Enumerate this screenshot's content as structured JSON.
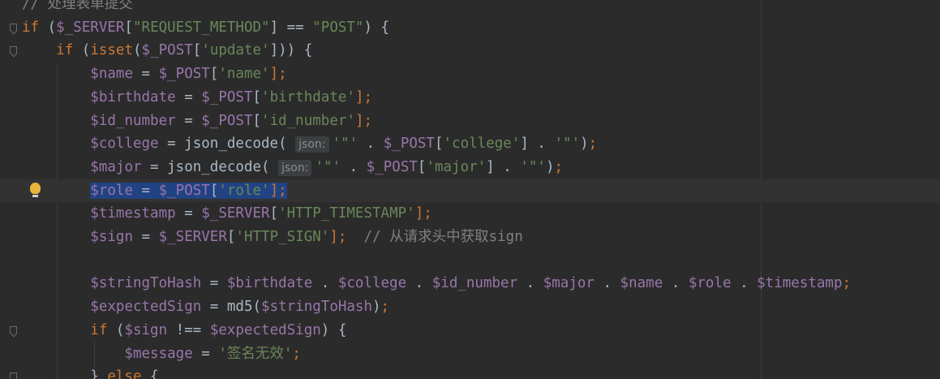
{
  "editor": {
    "language": "php",
    "colors": {
      "background": "#2b2b2b",
      "keyword": "#cc7832",
      "variable": "#9876aa",
      "string": "#6a8759",
      "function": "#ffc66d",
      "comment": "#808080",
      "selection": "#214283"
    },
    "lines": [
      {
        "tokens": [
          {
            "t": "cm",
            "v": "// 处理表单提交"
          }
        ]
      },
      {
        "fold": true,
        "tokens": [
          {
            "t": "kw",
            "v": "if"
          },
          {
            "t": "punct",
            "v": " ("
          },
          {
            "t": "var",
            "v": "$_SERVER"
          },
          {
            "t": "punct",
            "v": "["
          },
          {
            "t": "str",
            "v": "\"REQUEST_METHOD\""
          },
          {
            "t": "punct",
            "v": "] == "
          },
          {
            "t": "str",
            "v": "\"POST\""
          },
          {
            "t": "punct",
            "v": ") {"
          }
        ]
      },
      {
        "fold": true,
        "tokens": [
          {
            "t": "punct",
            "v": "    "
          },
          {
            "t": "kw",
            "v": "if"
          },
          {
            "t": "punct",
            "v": " ("
          },
          {
            "t": "kw",
            "v": "isset"
          },
          {
            "t": "punct",
            "v": "("
          },
          {
            "t": "var",
            "v": "$_POST"
          },
          {
            "t": "punct",
            "v": "["
          },
          {
            "t": "str",
            "v": "'update'"
          },
          {
            "t": "punct",
            "v": "])) {"
          }
        ]
      },
      {
        "tokens": [
          {
            "t": "punct",
            "v": "        "
          },
          {
            "t": "var",
            "v": "$name"
          },
          {
            "t": "punct",
            "v": " = "
          },
          {
            "t": "var",
            "v": "$_POST"
          },
          {
            "t": "punct",
            "v": "["
          },
          {
            "t": "str",
            "v": "'name'"
          },
          {
            "t": "kw",
            "v": "];"
          }
        ]
      },
      {
        "tokens": [
          {
            "t": "punct",
            "v": "        "
          },
          {
            "t": "var",
            "v": "$birthdate"
          },
          {
            "t": "punct",
            "v": " = "
          },
          {
            "t": "var",
            "v": "$_POST"
          },
          {
            "t": "punct",
            "v": "["
          },
          {
            "t": "str",
            "v": "'birthdate'"
          },
          {
            "t": "kw",
            "v": "];"
          }
        ]
      },
      {
        "tokens": [
          {
            "t": "punct",
            "v": "        "
          },
          {
            "t": "var",
            "v": "$id_number"
          },
          {
            "t": "punct",
            "v": " = "
          },
          {
            "t": "var",
            "v": "$_POST"
          },
          {
            "t": "punct",
            "v": "["
          },
          {
            "t": "str",
            "v": "'id_number'"
          },
          {
            "t": "kw",
            "v": "];"
          }
        ]
      },
      {
        "tokens": [
          {
            "t": "punct",
            "v": "        "
          },
          {
            "t": "var",
            "v": "$college"
          },
          {
            "t": "punct",
            "v": " = "
          },
          {
            "t": "id",
            "v": "json_decode"
          },
          {
            "t": "punct",
            "v": "( "
          },
          {
            "t": "hint",
            "v": "json:"
          },
          {
            "t": "str",
            "v": "'\"'"
          },
          {
            "t": "punct",
            "v": " . "
          },
          {
            "t": "var",
            "v": "$_POST"
          },
          {
            "t": "punct",
            "v": "["
          },
          {
            "t": "str",
            "v": "'college'"
          },
          {
            "t": "punct",
            "v": "] . "
          },
          {
            "t": "str",
            "v": "'\"'"
          },
          {
            "t": "punct",
            "v": ")"
          },
          {
            "t": "kw",
            "v": ";"
          }
        ]
      },
      {
        "tokens": [
          {
            "t": "punct",
            "v": "        "
          },
          {
            "t": "var",
            "v": "$major"
          },
          {
            "t": "punct",
            "v": " = "
          },
          {
            "t": "id",
            "v": "json_decode"
          },
          {
            "t": "punct",
            "v": "( "
          },
          {
            "t": "hint",
            "v": "json:"
          },
          {
            "t": "str",
            "v": "'\"'"
          },
          {
            "t": "punct",
            "v": " . "
          },
          {
            "t": "var",
            "v": "$_POST"
          },
          {
            "t": "punct",
            "v": "["
          },
          {
            "t": "str",
            "v": "'major'"
          },
          {
            "t": "punct",
            "v": "] . "
          },
          {
            "t": "str",
            "v": "'\"'"
          },
          {
            "t": "punct",
            "v": ")"
          },
          {
            "t": "kw",
            "v": ";"
          }
        ]
      },
      {
        "current": true,
        "bulb": true,
        "selected": true,
        "tokens": [
          {
            "t": "punct",
            "v": "        "
          },
          {
            "t": "var",
            "v": "$role"
          },
          {
            "t": "punct",
            "v": " = "
          },
          {
            "t": "var",
            "v": "$_POST"
          },
          {
            "t": "punct",
            "v": "["
          },
          {
            "t": "str",
            "v": "'role'"
          },
          {
            "t": "kw",
            "v": "];"
          }
        ]
      },
      {
        "tokens": [
          {
            "t": "punct",
            "v": "        "
          },
          {
            "t": "var",
            "v": "$timestamp"
          },
          {
            "t": "punct",
            "v": " = "
          },
          {
            "t": "var",
            "v": "$_SERVER"
          },
          {
            "t": "punct",
            "v": "["
          },
          {
            "t": "str",
            "v": "'HTTP_TIMESTAMP'"
          },
          {
            "t": "kw",
            "v": "];"
          }
        ]
      },
      {
        "tokens": [
          {
            "t": "punct",
            "v": "        "
          },
          {
            "t": "var",
            "v": "$sign"
          },
          {
            "t": "punct",
            "v": " = "
          },
          {
            "t": "var",
            "v": "$_SERVER"
          },
          {
            "t": "punct",
            "v": "["
          },
          {
            "t": "str",
            "v": "'HTTP_SIGN'"
          },
          {
            "t": "kw",
            "v": "];"
          },
          {
            "t": "punct",
            "v": "  "
          },
          {
            "t": "cm",
            "v": "// 从请求头中获取sign"
          }
        ]
      },
      {
        "tokens": []
      },
      {
        "tokens": [
          {
            "t": "punct",
            "v": "        "
          },
          {
            "t": "var",
            "v": "$stringToHash"
          },
          {
            "t": "punct",
            "v": " = "
          },
          {
            "t": "var",
            "v": "$birthdate"
          },
          {
            "t": "punct",
            "v": " . "
          },
          {
            "t": "var",
            "v": "$college"
          },
          {
            "t": "punct",
            "v": " . "
          },
          {
            "t": "var",
            "v": "$id_number"
          },
          {
            "t": "punct",
            "v": " . "
          },
          {
            "t": "var",
            "v": "$major"
          },
          {
            "t": "punct",
            "v": " . "
          },
          {
            "t": "var",
            "v": "$name"
          },
          {
            "t": "punct",
            "v": " . "
          },
          {
            "t": "var",
            "v": "$role"
          },
          {
            "t": "punct",
            "v": " . "
          },
          {
            "t": "var",
            "v": "$timestamp"
          },
          {
            "t": "kw",
            "v": ";"
          }
        ]
      },
      {
        "tokens": [
          {
            "t": "punct",
            "v": "        "
          },
          {
            "t": "var",
            "v": "$expectedSign"
          },
          {
            "t": "punct",
            "v": " = "
          },
          {
            "t": "id",
            "v": "md5"
          },
          {
            "t": "punct",
            "v": "("
          },
          {
            "t": "var",
            "v": "$stringToHash"
          },
          {
            "t": "punct",
            "v": ")"
          },
          {
            "t": "kw",
            "v": ";"
          }
        ]
      },
      {
        "fold": true,
        "tokens": [
          {
            "t": "punct",
            "v": "        "
          },
          {
            "t": "kw",
            "v": "if"
          },
          {
            "t": "punct",
            "v": " ("
          },
          {
            "t": "var",
            "v": "$sign"
          },
          {
            "t": "punct",
            "v": " !== "
          },
          {
            "t": "var",
            "v": "$expectedSign"
          },
          {
            "t": "punct",
            "v": ") {"
          }
        ]
      },
      {
        "tokens": [
          {
            "t": "punct",
            "v": "            "
          },
          {
            "t": "var",
            "v": "$message"
          },
          {
            "t": "punct",
            "v": " = "
          },
          {
            "t": "str",
            "v": "'签名无效'"
          },
          {
            "t": "kw",
            "v": ";"
          }
        ]
      },
      {
        "fold": true,
        "tokens": [
          {
            "t": "punct",
            "v": "        } "
          },
          {
            "t": "kw",
            "v": "else"
          },
          {
            "t": "punct",
            "v": " {"
          }
        ]
      }
    ]
  }
}
